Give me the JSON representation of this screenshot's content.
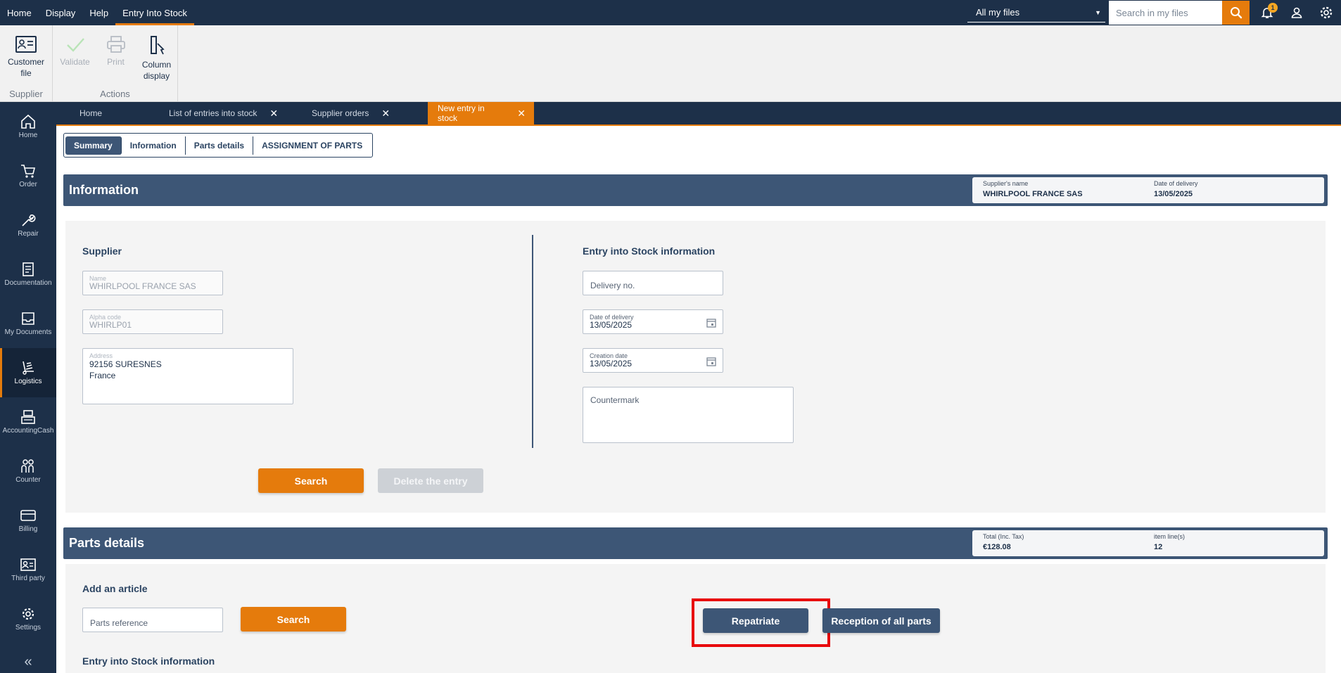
{
  "topbar": {
    "menu": [
      "Home",
      "Display",
      "Help",
      "Entry Into Stock"
    ],
    "file_filter": "All my files",
    "search_placeholder": "Search in my files",
    "notification_count": "1"
  },
  "ribbon": {
    "supplier_group": {
      "label": "Supplier",
      "customer_file": "Customer file"
    },
    "actions_group": {
      "label": "Actions",
      "validate": "Validate",
      "print": "Print",
      "column_display": "Column display"
    }
  },
  "sidebar": [
    "Home",
    "Order",
    "Repair",
    "Documentation",
    "My Documents",
    "Logistics",
    "AccountingCash",
    "Counter",
    "Billing",
    "Third party",
    "Settings"
  ],
  "tabs": [
    "Home",
    "List of entries into stock",
    "Supplier orders",
    "New entry in stock"
  ],
  "segments": [
    "Summary",
    "Information",
    "Parts details",
    "ASSIGNMENT OF PARTS"
  ],
  "information": {
    "title": "Information",
    "summary": {
      "supplier_label": "Supplier's name",
      "supplier_value": "WHIRLPOOL FRANCE SAS",
      "date_label": "Date of delivery",
      "date_value": "13/05/2025"
    },
    "supplier": {
      "title": "Supplier",
      "name_label": "Name",
      "name_value": "WHIRLPOOL FRANCE SAS",
      "alpha_label": "Alpha code",
      "alpha_value": "WHIRLP01",
      "address_label": "Address",
      "address_line1": "92156 SURESNES",
      "address_line2": "France"
    },
    "entry": {
      "title": "Entry into Stock information",
      "delivery_no_placeholder": "Delivery no.",
      "date_delivery_label": "Date of delivery",
      "date_delivery_value": "13/05/2025",
      "creation_label": "Creation date",
      "creation_value": "13/05/2025",
      "countermark_placeholder": "Countermark"
    },
    "search_button": "Search",
    "delete_button": "Delete the entry"
  },
  "parts": {
    "title": "Parts details",
    "summary": {
      "total_label": "Total (Inc. Tax)",
      "total_value": "€128.08",
      "lines_label": "item line(s)",
      "lines_value": "12"
    },
    "add_article_title": "Add an article",
    "reference_placeholder": "Parts reference",
    "search_button": "Search",
    "repatriate_button": "Repatriate",
    "reception_button": "Reception of all parts",
    "entry_info_title": "Entry into Stock information"
  },
  "colors": {
    "navy": "#1d3049",
    "panel": "#3d5676",
    "accent": "#e57b0c",
    "highlight": "#e8070b"
  }
}
